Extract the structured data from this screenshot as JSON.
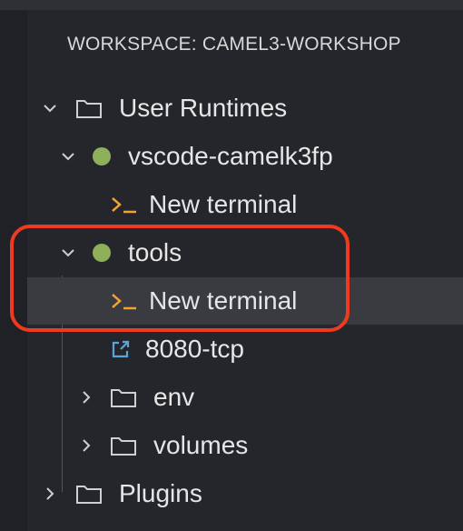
{
  "workspace": {
    "title": "WORKSPACE: CAMEL3-WORKSHOP"
  },
  "tree": {
    "user_runtimes": "User Runtimes",
    "runtime_1": "vscode-camelk3fp",
    "runtime_1_terminal": "New terminal",
    "runtime_2": "tools",
    "runtime_2_terminal": "New terminal",
    "runtime_2_port": "8080-tcp",
    "env": "env",
    "volumes": "volumes",
    "plugins": "Plugins"
  },
  "colors": {
    "status_green": "#8fb05a",
    "terminal_orange": "#f3a23a",
    "link_blue": "#59a4d9",
    "highlight_red": "#f03a20"
  },
  "icons": {
    "folder": "folder-icon",
    "status": "status-dot-icon",
    "terminal": "terminal-icon",
    "external_link": "external-link-icon",
    "chevron_down": "chevron-down-icon",
    "chevron_right": "chevron-right-icon"
  }
}
